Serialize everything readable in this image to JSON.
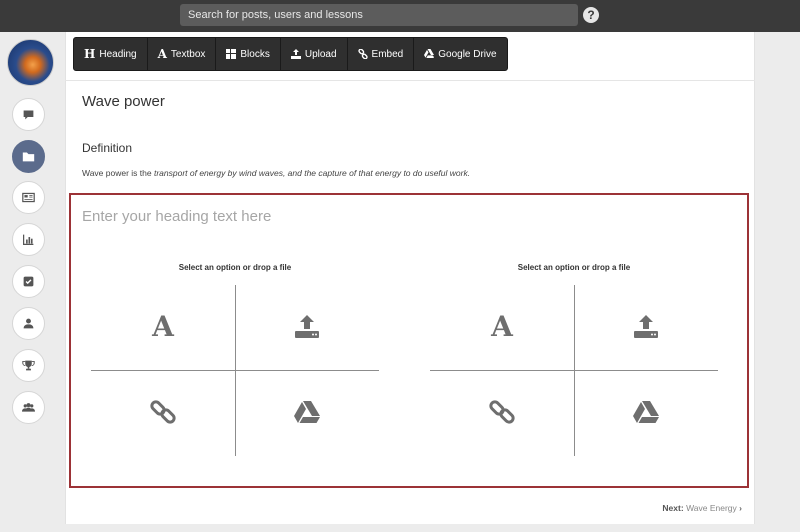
{
  "topbar": {
    "search_placeholder": "Search for posts, users and lessons",
    "help_label": "?"
  },
  "rail": {
    "items": [
      {
        "name": "chat",
        "icon": "chat-bubble-icon"
      },
      {
        "name": "folder",
        "icon": "folder-icon",
        "active": true
      },
      {
        "name": "news",
        "icon": "newspaper-icon"
      },
      {
        "name": "stats",
        "icon": "bar-chart-icon"
      },
      {
        "name": "tasks",
        "icon": "checkbox-icon"
      },
      {
        "name": "profile",
        "icon": "user-icon"
      },
      {
        "name": "trophy",
        "icon": "trophy-icon"
      },
      {
        "name": "groups",
        "icon": "group-icon"
      }
    ]
  },
  "toolbar": {
    "heading": "Heading",
    "textbox": "Textbox",
    "blocks": "Blocks",
    "upload": "Upload",
    "embed": "Embed",
    "drive": "Google Drive"
  },
  "page": {
    "title": "Wave power",
    "definition_title": "Definition",
    "definition_prefix": "Wave power is the ",
    "definition_emph": "transport of energy by wind waves, and the capture of that energy to do useful work."
  },
  "editor": {
    "heading_placeholder": "Enter your heading text here",
    "left_panel_title": "Select an option or drop a file",
    "right_panel_title": "Select an option or drop a file"
  },
  "footer": {
    "next_label": "Next:",
    "next_target": "Wave Energy"
  },
  "colors": {
    "topbar": "#3a3a3a",
    "block_border": "#9c3236",
    "toolbar": "#2f2f2f",
    "active_rail": "#5b6b8c"
  }
}
